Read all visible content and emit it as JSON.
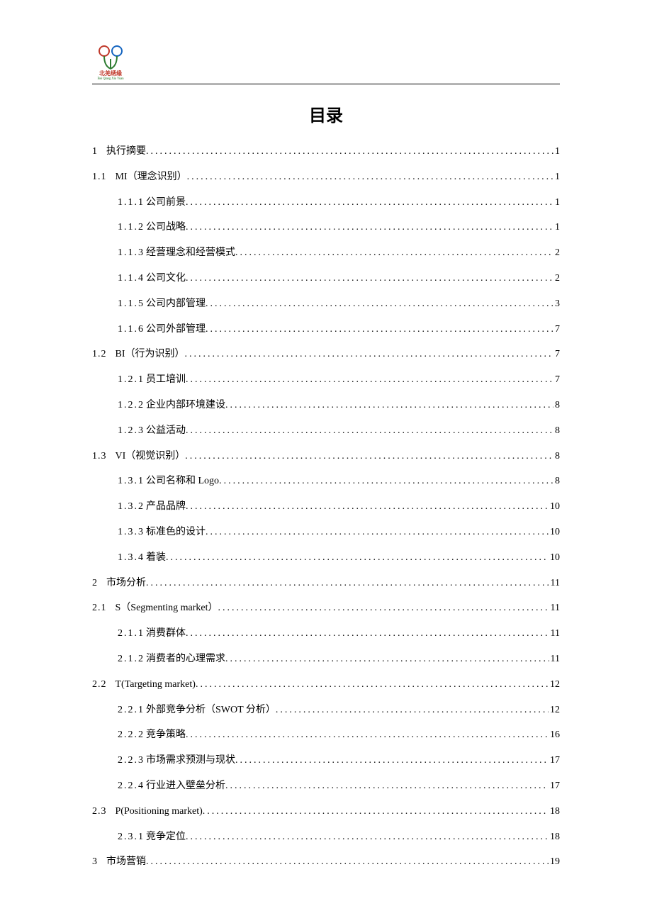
{
  "logo": {
    "cn": "北羌绣缘",
    "en": "Bei Qiang Xiu Yuan"
  },
  "title": "目录",
  "toc": [
    {
      "level": 1,
      "num": "1",
      "label": "执行摘要",
      "page": "1"
    },
    {
      "level": 2,
      "num": "1.1",
      "label": "MI（理念识别）",
      "page": "1"
    },
    {
      "level": 3,
      "num": "1.1.1",
      "label": "公司前景",
      "page": "1"
    },
    {
      "level": 3,
      "num": "1.1.2",
      "label": "公司战略",
      "page": "1"
    },
    {
      "level": 3,
      "num": "1.1.3",
      "label": "经营理念和经营模式",
      "page": "2"
    },
    {
      "level": 3,
      "num": "1.1.4",
      "label": "公司文化",
      "page": "2"
    },
    {
      "level": 3,
      "num": "1.1.5",
      "label": "公司内部管理",
      "page": "3"
    },
    {
      "level": 3,
      "num": "1.1.6",
      "label": "公司外部管理",
      "page": "7"
    },
    {
      "level": 2,
      "num": "1.2",
      "label": "BI（行为识别）",
      "page": "7"
    },
    {
      "level": 3,
      "num": "1.2.1",
      "label": "员工培训",
      "page": "7"
    },
    {
      "level": 3,
      "num": "1.2.2",
      "label": "企业内部环境建设",
      "page": "8"
    },
    {
      "level": 3,
      "num": "1.2.3",
      "label": "公益活动",
      "page": "8"
    },
    {
      "level": 2,
      "num": "1.3",
      "label": "VI（视觉识别）",
      "page": "8"
    },
    {
      "level": 3,
      "num": "1.3.1",
      "label": "公司名称和 Logo",
      "page": "8"
    },
    {
      "level": 3,
      "num": "1.3.2",
      "label": "产品品牌",
      "page": "10"
    },
    {
      "level": 3,
      "num": "1.3.3",
      "label": "标准色的设计",
      "page": "10"
    },
    {
      "level": 3,
      "num": "1.3.4",
      "label": "着装",
      "page": "10"
    },
    {
      "level": 1,
      "num": "2",
      "label": "市场分析",
      "page": "11"
    },
    {
      "level": 2,
      "num": "2.1",
      "label": "S（Segmenting  market）",
      "page": "11"
    },
    {
      "level": 3,
      "num": "2.1.1",
      "label": "消费群体",
      "page": "11"
    },
    {
      "level": 3,
      "num": "2.1.2",
      "label": "消费者的心理需求",
      "page": "11"
    },
    {
      "level": 2,
      "num": "2.2",
      "label": "T(Targeting   market)",
      "page": "12"
    },
    {
      "level": 3,
      "num": "2.2.1",
      "label": "外部竞争分析（SWOT 分析）",
      "page": "12"
    },
    {
      "level": 3,
      "num": "2.2.2",
      "label": "竞争策略",
      "page": "16"
    },
    {
      "level": 3,
      "num": "2.2.3",
      "label": "市场需求预测与现状",
      "page": "17"
    },
    {
      "level": 3,
      "num": "2.2.4",
      "label": "行业进入壁垒分析",
      "page": "17"
    },
    {
      "level": 2,
      "num": "2.3",
      "label": "P(Positioning  market)",
      "page": "18"
    },
    {
      "level": 3,
      "num": "2.3.1",
      "label": "竞争定位",
      "page": "18"
    },
    {
      "level": 1,
      "num": "3",
      "label": "市场营销",
      "page": "19"
    }
  ]
}
